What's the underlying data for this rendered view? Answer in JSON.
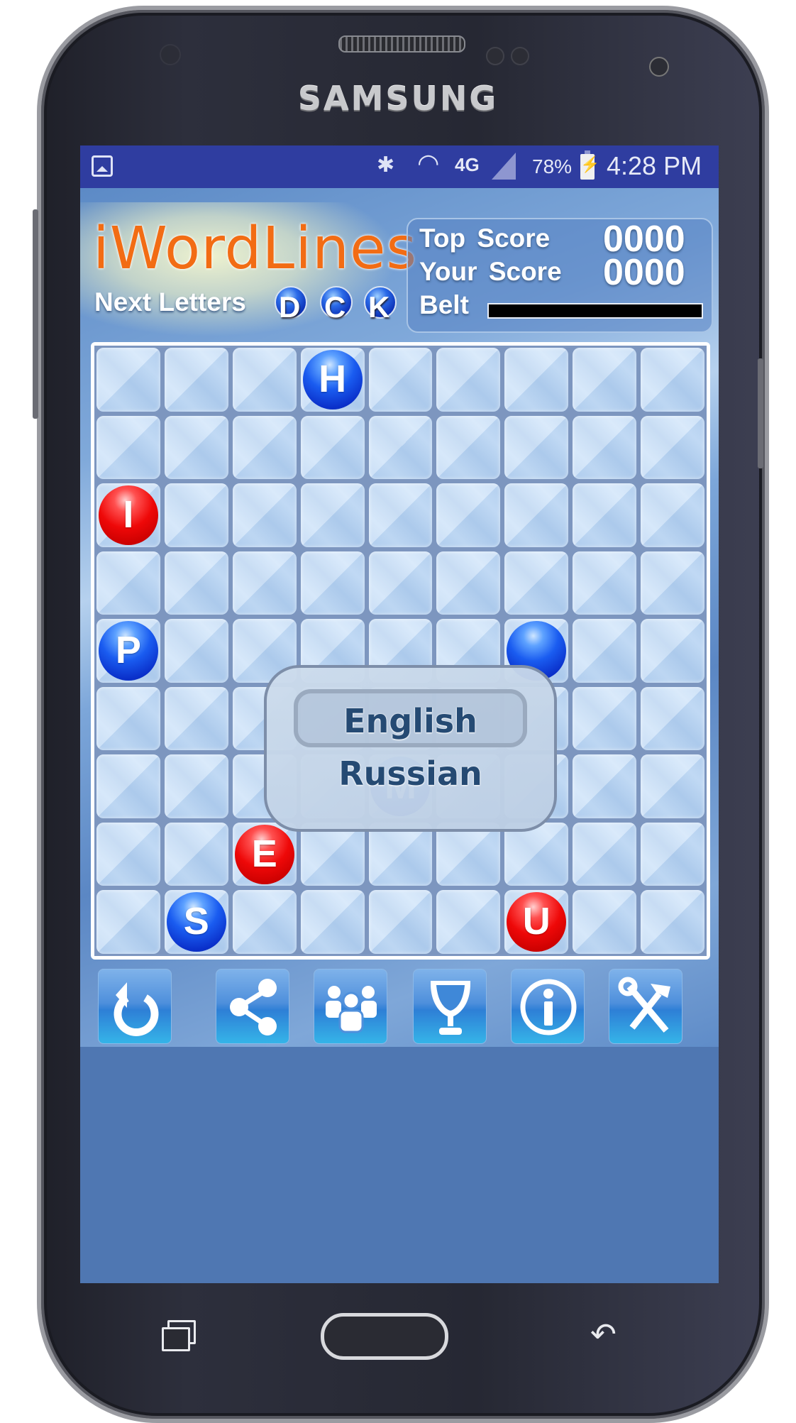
{
  "device": {
    "brand": "SAMSUNG"
  },
  "status_bar": {
    "notification_icon": "gallery-icon",
    "bluetooth_icon": "bluetooth-icon",
    "wifi_icon": "wifi-icon",
    "network": "4G",
    "battery_percent": "78%",
    "time": "4:28 PM"
  },
  "header": {
    "app_title": "iWordLines",
    "next_letters_label": "Next Letters",
    "next_letters": [
      "D",
      "C",
      "K"
    ],
    "top_score_label": "Top  Score",
    "top_score": "0000",
    "your_score_label": "Your Score",
    "your_score": "0000",
    "belt_label": "Belt",
    "belt_progress": 0
  },
  "board": {
    "rows": 9,
    "cols": 9,
    "balls": [
      {
        "row": 0,
        "col": 3,
        "letter": "H",
        "color": "blue"
      },
      {
        "row": 2,
        "col": 0,
        "letter": "I",
        "color": "red"
      },
      {
        "row": 4,
        "col": 0,
        "letter": "P",
        "color": "blue"
      },
      {
        "row": 4,
        "col": 6,
        "letter": "",
        "color": "blue"
      },
      {
        "row": 6,
        "col": 4,
        "letter": "M",
        "color": "blue"
      },
      {
        "row": 7,
        "col": 2,
        "letter": "E",
        "color": "red"
      },
      {
        "row": 8,
        "col": 1,
        "letter": "S",
        "color": "blue"
      },
      {
        "row": 8,
        "col": 6,
        "letter": "U",
        "color": "red"
      }
    ]
  },
  "language_dialog": {
    "options": [
      "English",
      "Russian"
    ],
    "selected": "English"
  },
  "toolbar": {
    "buttons": [
      {
        "name": "restart",
        "icon": "restart-icon"
      },
      {
        "name": "share",
        "icon": "share-icon"
      },
      {
        "name": "community",
        "icon": "people-icon"
      },
      {
        "name": "leaderboard",
        "icon": "trophy-icon"
      },
      {
        "name": "info",
        "icon": "info-icon"
      },
      {
        "name": "settings",
        "icon": "tools-icon"
      }
    ]
  },
  "colors": {
    "status_bar": "#2f3da0",
    "logo": "#f26c14",
    "ball_blue": "#1a5cf0",
    "ball_red": "#ee0808",
    "dialog_text": "#254a73",
    "app_bg_bottom": "#4f77b2"
  }
}
